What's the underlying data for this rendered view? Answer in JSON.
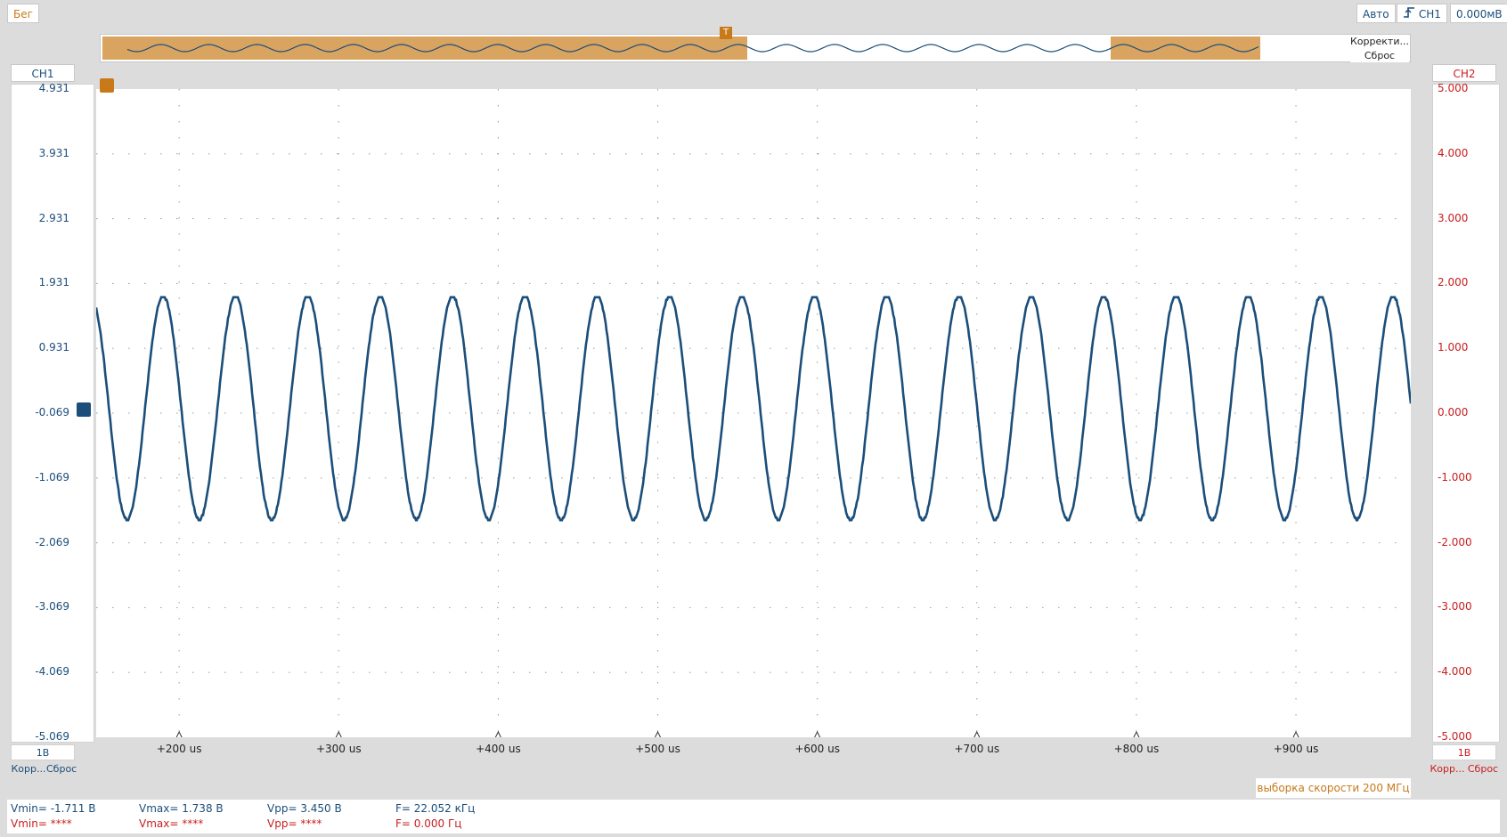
{
  "toolbar": {
    "status": "Бег",
    "mode": "Авто",
    "trigger_channel": "CH1",
    "trigger_level": "0.000мВ"
  },
  "overview": {
    "correction_label": "Корректи...",
    "reset_label": "Сброс"
  },
  "ch1": {
    "title": "CH1",
    "scale": "1В",
    "corr": "Корр...",
    "reset": "Сброс",
    "ticks": [
      "4.931",
      "3.931",
      "2.931",
      "1.931",
      "0.931",
      "-0.069",
      "-1.069",
      "-2.069",
      "-3.069",
      "-4.069",
      "-5.069"
    ]
  },
  "ch2": {
    "title": "CH2",
    "scale": "1В",
    "corr": "Корр...",
    "reset": "Сброс",
    "ticks": [
      "5.000",
      "4.000",
      "3.000",
      "2.000",
      "1.000",
      "0.000",
      "-1.000",
      "-2.000",
      "-3.000",
      "-4.000",
      "-5.000"
    ]
  },
  "time_axis": {
    "labels": [
      "+200 us",
      "+300 us",
      "+400 us",
      "+500 us",
      "+600 us",
      "+700 us",
      "+800 us",
      "+900 us"
    ]
  },
  "sample_rate": "выборка скорости 200 МГц",
  "measurements": {
    "ch1": {
      "vmin": "Vmin= -1.711 В",
      "vmax": "Vmax= 1.738 В",
      "vpp": "Vpp= 3.450 В",
      "freq": "F= 22.052 кГц"
    },
    "ch2": {
      "vmin": "Vmin= ****",
      "vmax": "Vmax= ****",
      "vpp": "Vpp= ****",
      "freq": "F= 0.000 Гц"
    }
  },
  "colors": {
    "ch1": "#1b4e7a",
    "ch2": "#c81e1e",
    "accent": "#d9a460",
    "marker": "#c87a1a"
  },
  "chart_data": {
    "type": "line",
    "x_range_us": [
      148,
      972
    ],
    "y_range_ch1": [
      -5.069,
      4.931
    ],
    "y_range_ch2": [
      -5.0,
      5.0
    ],
    "grid": true,
    "series": [
      {
        "name": "CH1",
        "waveform": "sine",
        "frequency_khz": 22.052,
        "vmin": -1.711,
        "vmax": 1.738
      }
    ]
  }
}
